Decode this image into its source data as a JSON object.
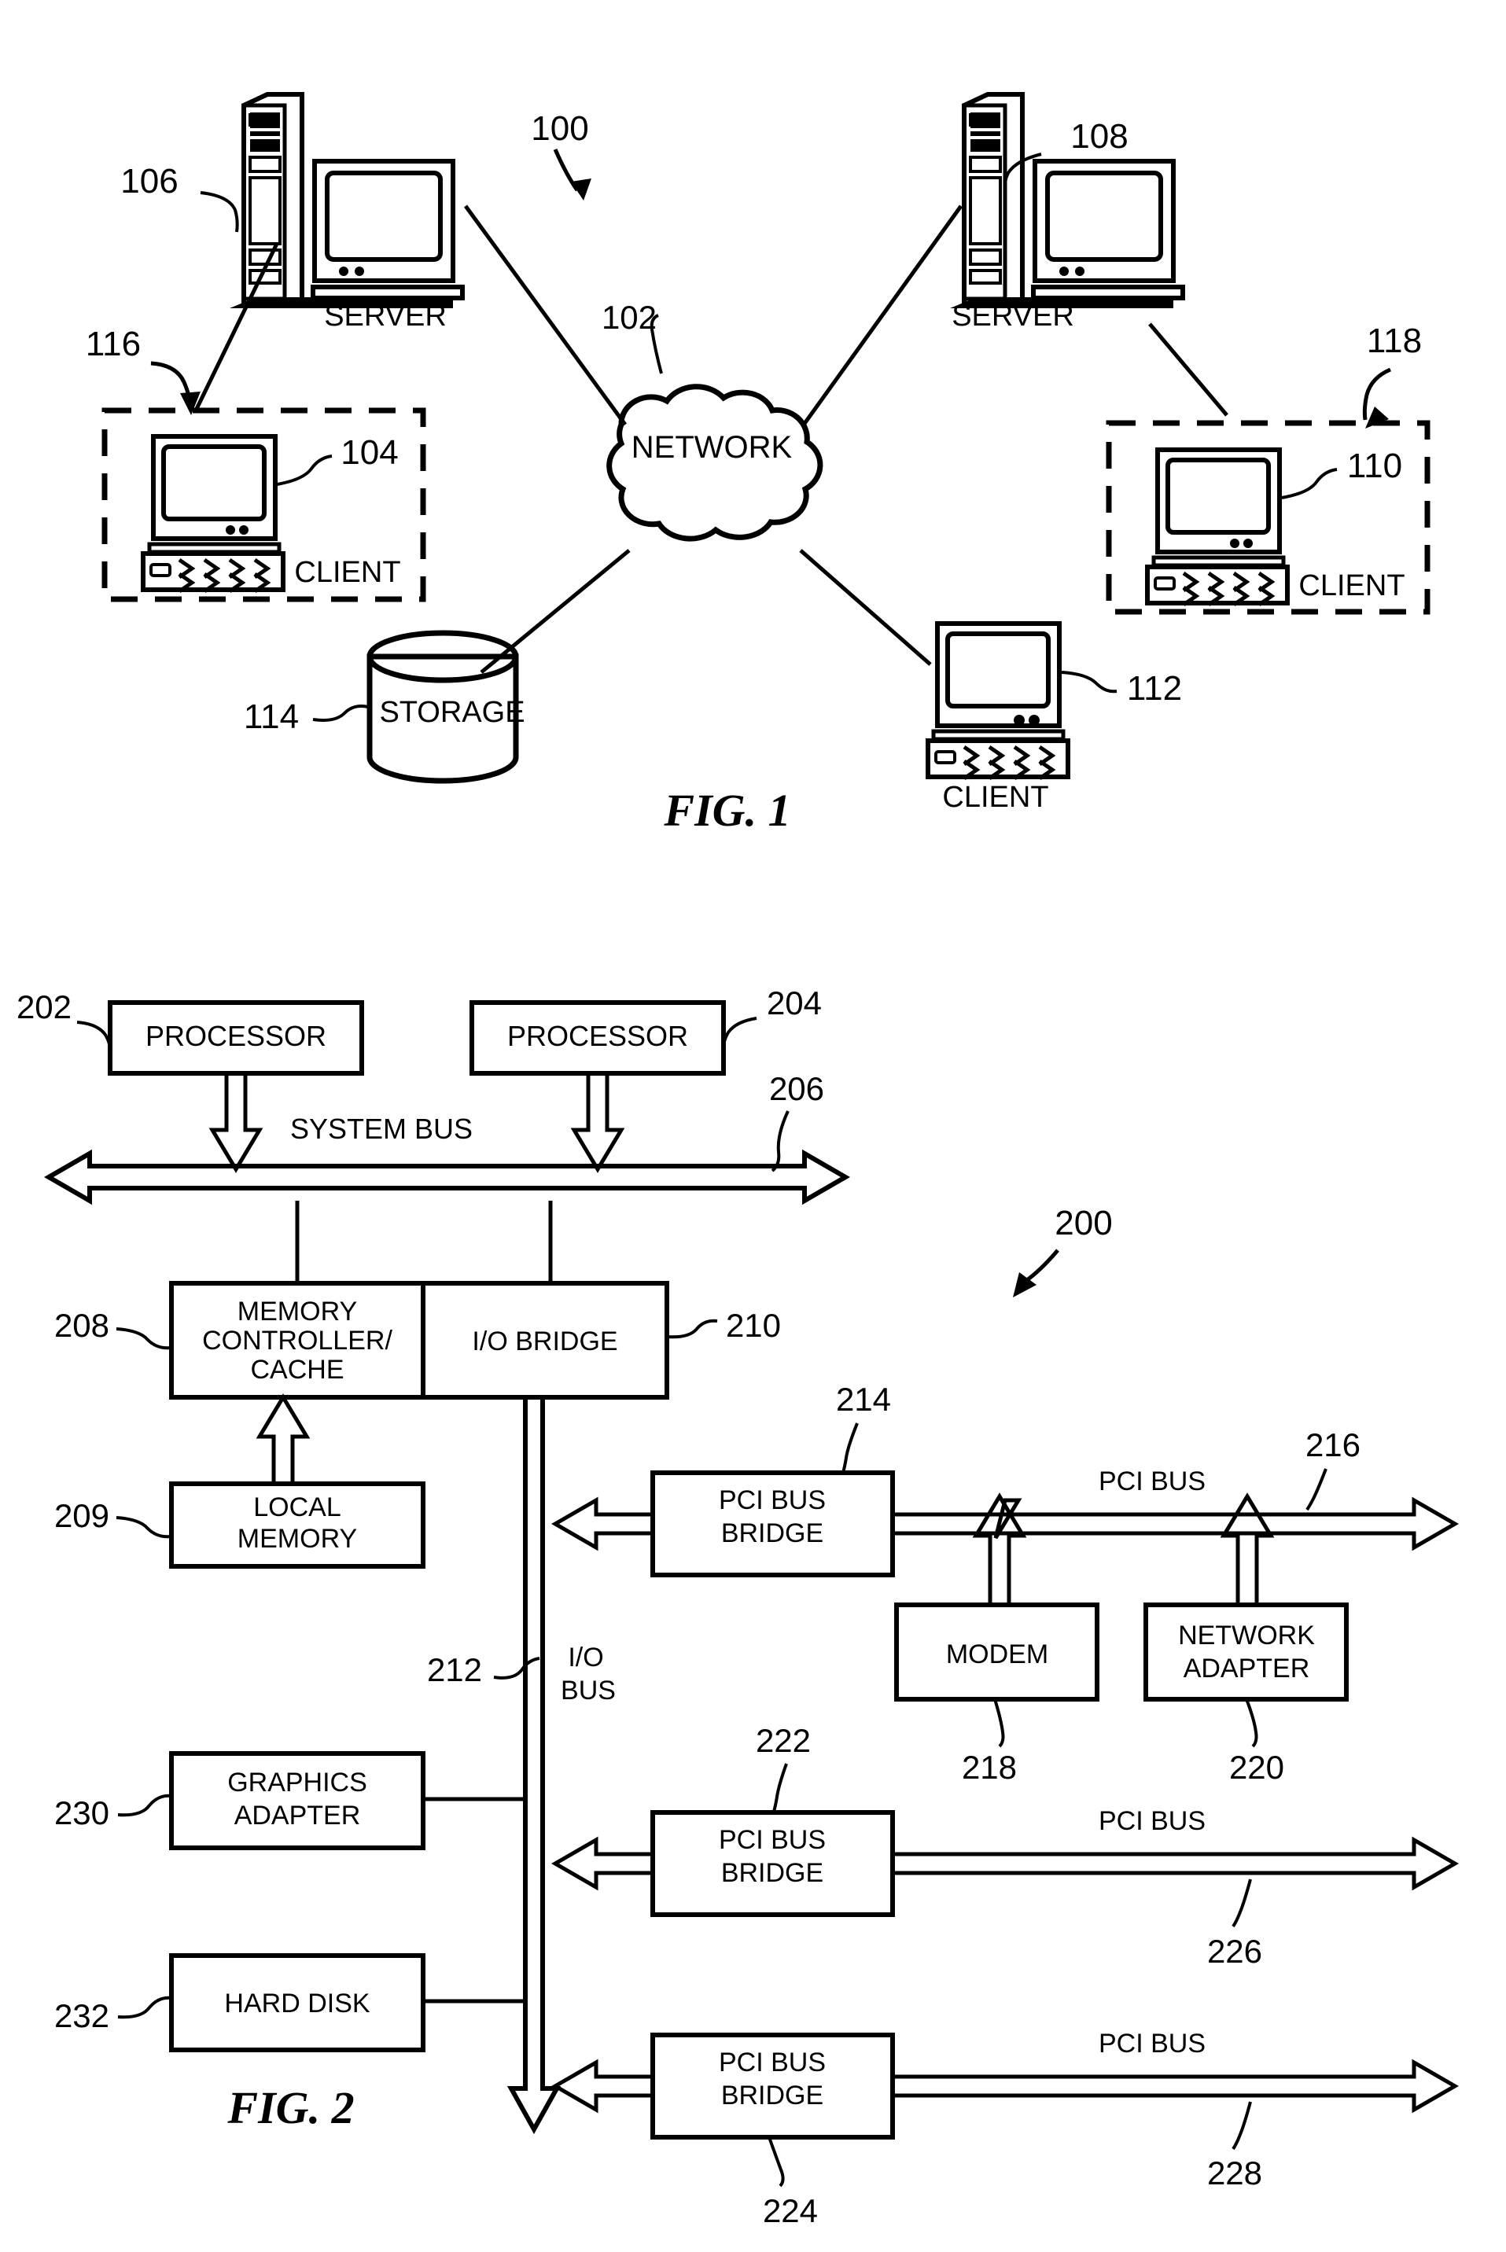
{
  "figures": [
    {
      "id": "fig1",
      "caption": "FIG. 1",
      "system_ref": "100",
      "nodes": {
        "network": {
          "label": "NETWORK",
          "ref": "102"
        },
        "server_left": {
          "label": "SERVER",
          "ref": "106"
        },
        "server_right": {
          "label": "SERVER",
          "ref": "108"
        },
        "client_left": {
          "label": "CLIENT",
          "ref": "104",
          "group_ref": "116"
        },
        "client_right": {
          "label": "CLIENT",
          "ref": "110",
          "group_ref": "118"
        },
        "client_bottom": {
          "label": "CLIENT",
          "ref": "112"
        },
        "storage": {
          "label": "STORAGE",
          "ref": "114"
        }
      }
    },
    {
      "id": "fig2",
      "caption": "FIG. 2",
      "system_ref": "200",
      "nodes": {
        "processor_1": {
          "label": "PROCESSOR",
          "ref": "202"
        },
        "processor_2": {
          "label": "PROCESSOR",
          "ref": "204"
        },
        "system_bus": {
          "label": "SYSTEM BUS",
          "ref": "206"
        },
        "memory_controller": {
          "label_line1": "MEMORY",
          "label_line2": "CONTROLLER/",
          "label_line3": "CACHE",
          "ref": "208"
        },
        "io_bridge": {
          "label": "I/O BRIDGE",
          "ref": "210"
        },
        "local_memory": {
          "label_line1": "LOCAL",
          "label_line2": "MEMORY",
          "ref": "209"
        },
        "io_bus": {
          "label_line1": "I/O",
          "label_line2": "BUS",
          "ref": "212"
        },
        "pci_bridge_1": {
          "label_line1": "PCI BUS",
          "label_line2": "BRIDGE",
          "ref": "214"
        },
        "pci_bus_1": {
          "label": "PCI BUS",
          "ref": "216"
        },
        "modem": {
          "label": "MODEM",
          "ref": "218"
        },
        "network_adapter": {
          "label_line1": "NETWORK",
          "label_line2": "ADAPTER",
          "ref": "220"
        },
        "pci_bridge_2": {
          "label_line1": "PCI BUS",
          "label_line2": "BRIDGE",
          "ref": "222"
        },
        "pci_bus_2": {
          "label": "PCI BUS",
          "ref": "226"
        },
        "pci_bridge_3": {
          "label_line1": "PCI BUS",
          "label_line2": "BRIDGE",
          "ref": "224"
        },
        "pci_bus_3": {
          "label": "PCI BUS",
          "ref": "228"
        },
        "graphics_adapter": {
          "label_line1": "GRAPHICS",
          "label_line2": "ADAPTER",
          "ref": "230"
        },
        "hard_disk": {
          "label": "HARD DISK",
          "ref": "232"
        }
      }
    }
  ],
  "colors": {
    "ink": "#000000",
    "paper": "#ffffff"
  }
}
